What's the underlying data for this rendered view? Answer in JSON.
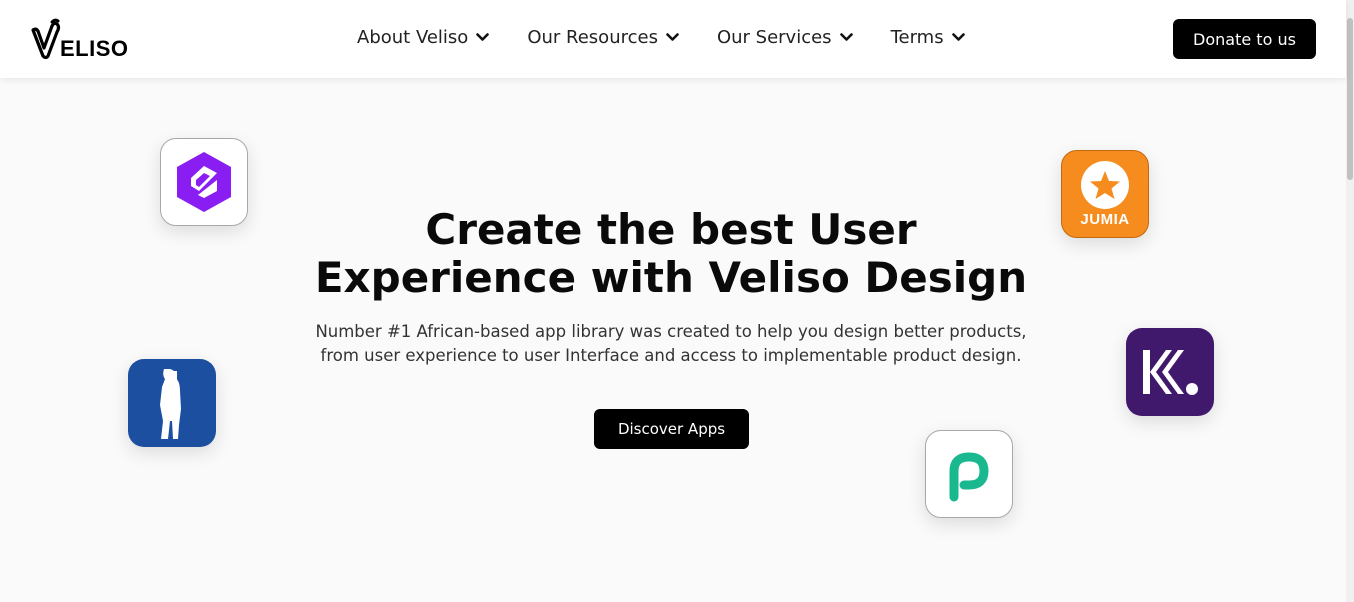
{
  "brand": {
    "logo_text": "ELISO"
  },
  "nav": {
    "items": [
      {
        "label": "About Veliso"
      },
      {
        "label": "Our Resources"
      },
      {
        "label": "Our Services"
      },
      {
        "label": "Terms"
      }
    ]
  },
  "header": {
    "donate_label": "Donate to us"
  },
  "hero": {
    "title_line1": "Create the best User",
    "title_line2": "Experience with Veliso Design",
    "subtitle_line1": "Number #1 African-based app library was created to help you design better products,",
    "subtitle_line2": "from user experience to user Interface and access to implementable product design.",
    "cta_label": "Discover Apps"
  },
  "apps": {
    "jumia_label": "JUMIA"
  },
  "colors": {
    "accent_black": "#000000",
    "jumia_orange": "#f68b1e",
    "kuda_purple": "#40196d",
    "purple_app": "#8a1ef2",
    "blue_app": "#1d4fa0",
    "piggy_green": "#1ab88f"
  },
  "icons": {
    "logo": "veliso-v-logo",
    "nav_chevron": "chevron-down-icon",
    "app_purple": "purple-hexagon-app-icon",
    "app_jumia": "jumia-star-app-icon",
    "app_blue": "person-silhouette-app-icon",
    "app_kuda": "kuda-k-app-icon",
    "app_p": "p-letter-app-icon"
  }
}
